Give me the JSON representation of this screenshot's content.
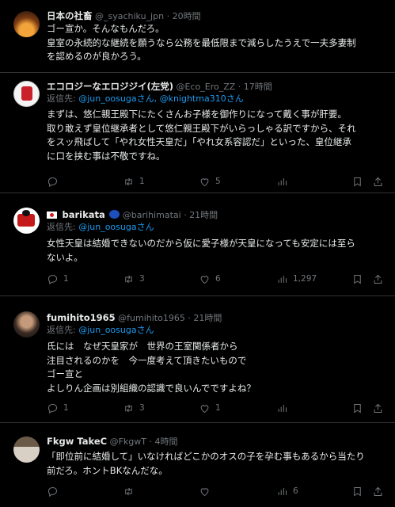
{
  "tweets": [
    {
      "name": "日本の社畜",
      "handle": "@_syachiku_jpn",
      "time": "20時間",
      "reply_prefix": "",
      "mentions": "",
      "reply_suffix": "",
      "body": "ゴー宣か。そんなもんだろ。\n皇室の永続的な継続を願うなら公務を最低限まで減らしたうえで一夫多妻制\nを認めるのが良かろう。",
      "counts": {
        "reply": "",
        "retweet": "",
        "like": "",
        "views": ""
      }
    },
    {
      "name": "エコロジーなエロジジイ(左党)",
      "handle": "@Eco_Ero_ZZ",
      "time": "17時間",
      "reply_prefix": "返信先: ",
      "mentions": "@jun_oosugaさん, @knightma310さん",
      "reply_suffix": "",
      "body": "まずは、悠仁親王殿下にたくさんお子様を御作りになって戴く事が肝要。\n取り敢えず皇位継承者として悠仁親王殿下がいらっしゃる訳ですから、それ\nをスッ飛ばして「やれ女性天皇だ」「やれ女系容認だ」といった、皇位継承\nに口を挟む事は不敬ですね。",
      "counts": {
        "reply": "",
        "retweet": "1",
        "like": "5",
        "views": ""
      }
    },
    {
      "name": "barikata",
      "handle": "@barihimatai",
      "time": "21時間",
      "reply_prefix": "返信先: ",
      "mentions": "@jun_oosugaさん",
      "reply_suffix": "",
      "body": "女性天皇は結婚できないのだから仮に愛子様が天皇になっても安定には至ら\nないよ。",
      "counts": {
        "reply": "1",
        "retweet": "3",
        "like": "6",
        "views": "1,297"
      }
    },
    {
      "name": "fumihito1965",
      "handle": "@fumihito1965",
      "time": "21時間",
      "reply_prefix": "返信先: ",
      "mentions": "@jun_oosugaさん",
      "reply_suffix": "",
      "body": "氏には　なぜ天皇家が　世界の王室関係者から\n注目されるのかを　今一度考えて頂きたいもので\nゴー宣と\nよしりん企画は別組織の認識で良いんでですよね？",
      "counts": {
        "reply": "1",
        "retweet": "3",
        "like": "1",
        "views": ""
      }
    },
    {
      "name": "Fkgw TakeC",
      "handle": "@FkgwT",
      "time": "4時間",
      "reply_prefix": "",
      "mentions": "",
      "reply_suffix": "",
      "body": "「即位前に結婚して」いなければどこかのオスの子を孕む事もあるから当たり\n前だろ。ホントBKなんだな。",
      "counts": {
        "reply": "",
        "retweet": "",
        "like": "",
        "views": "6"
      }
    }
  ]
}
